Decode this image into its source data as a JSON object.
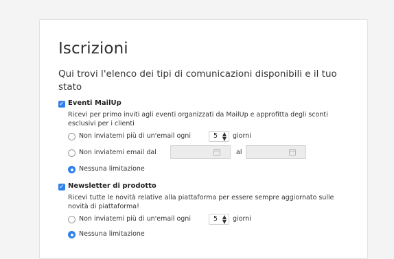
{
  "page": {
    "title": "Iscrizioni",
    "subtitle": "Qui trovi l'elenco dei tipi di comunicazioni disponibili e il tuo stato"
  },
  "groups": [
    {
      "title": "Eventi MailUp",
      "checked": true,
      "description": "Ricevi per primo inviti agli eventi organizzati da MailUp e approfitta degli sconti esclusivi per i clienti",
      "options": {
        "every_label": "Non inviatemi più di un'email ogni",
        "every_value": "5",
        "every_unit": "giorni",
        "range_label": "Non inviatemi email dal",
        "range_mid": "al",
        "none_label": "Nessuna limitazione"
      },
      "selected": "none"
    },
    {
      "title": "Newsletter di prodotto",
      "checked": true,
      "description": "Ricevi tutte le novità relative alla piattaforma per essere sempre aggiornato sulle novità di piattaforma!",
      "options": {
        "every_label": "Non inviatemi più di un'email ogni",
        "every_value": "5",
        "every_unit": "giorni",
        "none_label": "Nessuna limitazione"
      },
      "selected": "none"
    }
  ],
  "icons": {
    "checkbox": "checkmark-icon",
    "select_arrows": "updown-arrows-icon",
    "calendar": "calendar-icon"
  },
  "colors": {
    "accent": "#2f80ed",
    "background": "#f4f4f5",
    "card": "#ffffff",
    "disabled_input": "#ececec"
  }
}
